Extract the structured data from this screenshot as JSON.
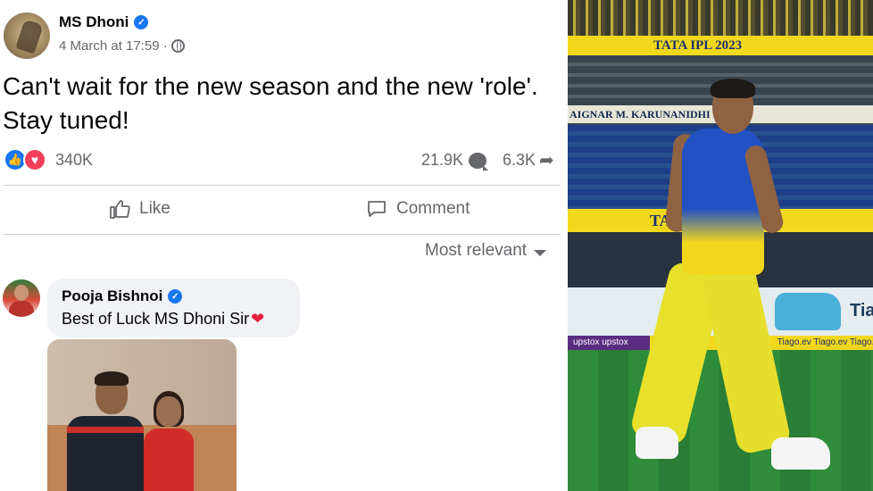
{
  "post": {
    "author": "MS Dhoni",
    "timestamp": "4 March at 17:59 ·",
    "text": "Can't wait for the new season and the new 'role'. Stay tuned!",
    "reactions_count": "340K",
    "comments_count": "21.9K",
    "shares_count": "6.3K",
    "actions": {
      "like_label": "Like",
      "comment_label": "Comment"
    },
    "sort_label": "Most relevant"
  },
  "comment": {
    "author": "Pooja Bishnoi",
    "text": "Best of Luck MS Dhoni Sir"
  },
  "photo": {
    "banner_top": "TATA IPL 2023",
    "banner_stand": "AIGNAR M. KARUNANIDHI",
    "banner_mid": "TATA",
    "ad_brand": "Tia",
    "strip_text": "upstox upstox",
    "strip_text_2": "Tiago.ev Tiago.ev Tiago.ev"
  },
  "colors": {
    "fb_blue": "#1877f2",
    "love_red": "#f33e58",
    "muted_text": "#65676b",
    "comment_bg": "#f0f2f5",
    "jersey_yellow": "#f2d81d"
  },
  "icons": {
    "verified": "verified-badge-icon",
    "audience": "globe-icon",
    "like_reaction": "like-reaction-icon",
    "love_reaction": "love-reaction-icon",
    "comment": "comment-bubble-icon",
    "share": "share-arrow-icon",
    "like_action": "thumbs-up-icon",
    "comment_action": "comment-icon",
    "sort": "caret-down-icon"
  }
}
